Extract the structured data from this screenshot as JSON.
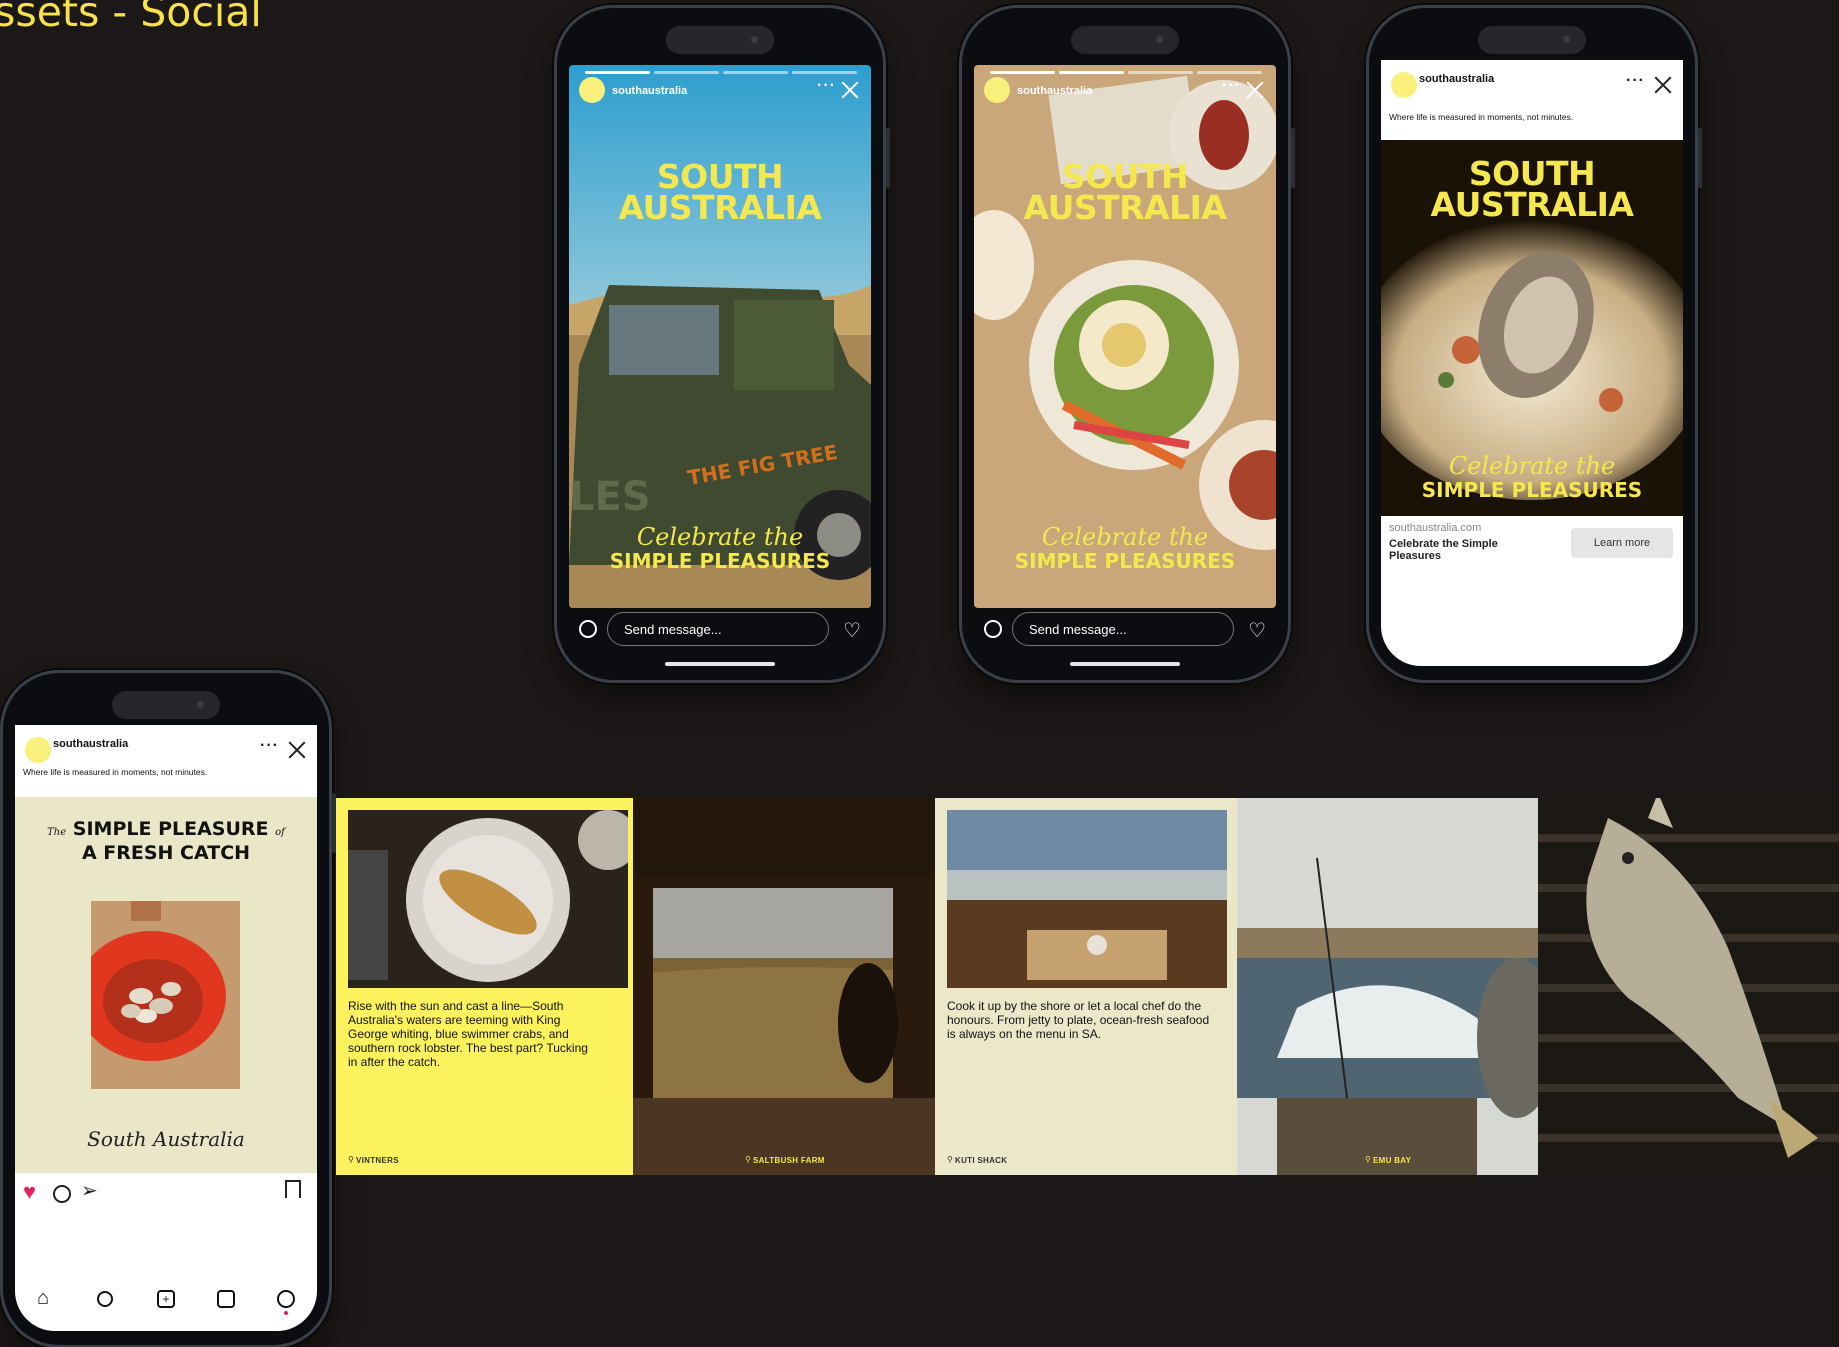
{
  "page": {
    "title": "ssets - Social"
  },
  "story1": {
    "handle": "southaustralia",
    "headline_l1": "SOUTH",
    "headline_l2": "AUSTRALIA",
    "script": "Celebrate the",
    "caps": "SIMPLE PLEASURES",
    "message": "Send message..."
  },
  "story2": {
    "handle": "southaustralia",
    "headline_l1": "SOUTH",
    "headline_l2": "AUSTRALIA",
    "script": "Celebrate the",
    "caps": "SIMPLE PLEASURES",
    "message": "Send message..."
  },
  "ad": {
    "handle": "southaustralia",
    "tagline": "Where life is measured in moments, not minutes.",
    "headline_l1": "SOUTH",
    "headline_l2": "AUSTRALIA",
    "script": "Celebrate the",
    "caps": "SIMPLE PLEASURES",
    "domain": "southaustralia.com",
    "cta_text": "Celebrate the Simple Pleasures",
    "button": "Learn more"
  },
  "feed": {
    "handle": "southaustralia",
    "tagline": "Where life is measured in moments, not minutes.",
    "small1": "The",
    "headline1": "SIMPLE PLEASURE",
    "small2": "of",
    "headline2": "A FRESH CATCH",
    "signature": "South Australia"
  },
  "carousel": {
    "tile1": {
      "text": "Rise with the sun and cast a line—South Australia's waters are teeming with King George whiting, blue swimmer crabs, and southern rock lobster. The best part? Tucking in after the catch.",
      "loc": "VINTNERS"
    },
    "tile2": {
      "loc": "SALTBUSH FARM"
    },
    "tile3": {
      "text": "Cook it up by the shore or let a local chef do the honours. From jetty to plate, ocean-fresh seafood is always on the menu in SA.",
      "loc": "KUTI SHACK"
    },
    "tile4": {
      "loc": "EMU BAY"
    }
  },
  "colors": {
    "brand_yellow": "#f5e74f",
    "bg": "#1d1818",
    "like_red": "#e0245e"
  }
}
